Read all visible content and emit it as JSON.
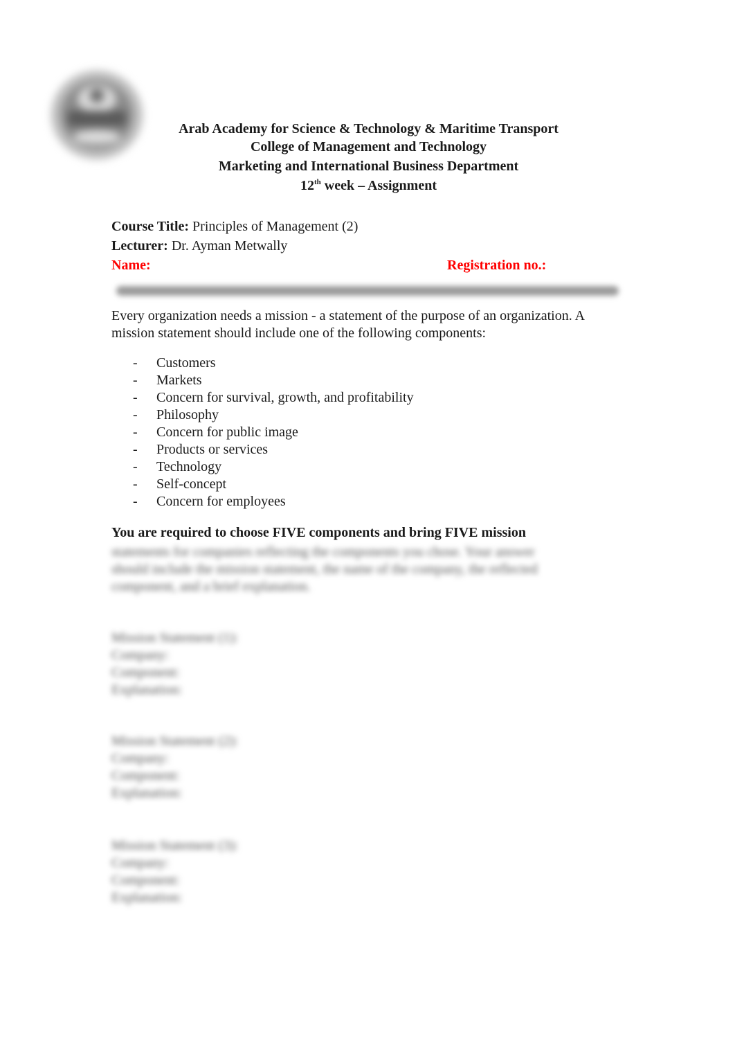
{
  "header": {
    "institution": "Arab Academy for Science & Technology & Maritime Transport",
    "college": "College of Management and Technology",
    "department": "Marketing and International Business Department",
    "week_number": "12",
    "week_suffix": "th",
    "week_rest": " week – Assignment"
  },
  "meta": {
    "course_label": "Course Title:",
    "course_value": " Principles of Management (2)",
    "lecturer_label": "Lecturer:",
    "lecturer_value": " Dr. Ayman Metwally",
    "name_label": "Name:",
    "registration_label": "Registration no.:"
  },
  "intro": "Every organization needs a mission - a statement of the purpose of an organization. A mission statement should include one of the following components:",
  "components": [
    "Customers",
    "Markets",
    "Concern for survival, growth, and profitability",
    "Philosophy",
    "Concern for public image",
    "Products or services",
    "Technology",
    "Self-concept",
    "Concern for employees"
  ],
  "bullet": "-",
  "instruction": "You are required to choose FIVE components and bring FIVE mission",
  "blurred": {
    "instruction_rest": [
      "statements for companies reflecting the components you chose. Your answer",
      "should include the mission statement, the name of the company, the reflected",
      "component, and a brief explanation."
    ],
    "sections": [
      {
        "title": "Mission Statement (1):",
        "lines": [
          "Company:",
          "Component:",
          "Explanation:"
        ]
      },
      {
        "title": "Mission Statement (2):",
        "lines": [
          "Company:",
          "Component:",
          "Explanation:"
        ]
      },
      {
        "title": "Mission Statement (3):",
        "lines": [
          "Company:",
          "Component:",
          "Explanation:"
        ]
      }
    ]
  }
}
